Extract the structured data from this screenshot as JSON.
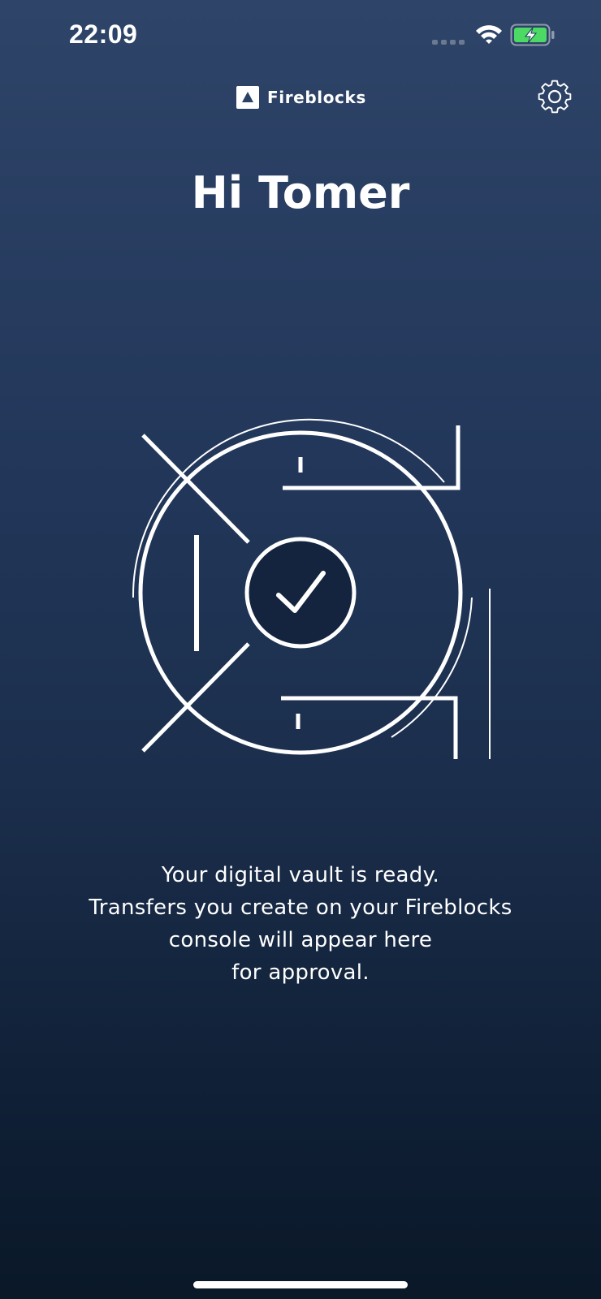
{
  "status_bar": {
    "time": "22:09",
    "icons": [
      "cellular-signal-icon",
      "wifi-icon",
      "battery-charging-icon"
    ],
    "battery_color": "#4cd964"
  },
  "header": {
    "brand_name": "Fireblocks",
    "logo_icon": "fireblocks-logo-icon",
    "settings_icon": "gear-icon"
  },
  "greeting": "Hi Tomer",
  "illustration": {
    "icon": "vault-check-icon",
    "inner_circle_color": "#14243f"
  },
  "message": {
    "lines": [
      "Your digital vault is ready.",
      "Transfers you create on your Fireblocks",
      "console will appear here",
      "for approval."
    ]
  },
  "theme": {
    "background_top": "#2e4468",
    "background_bottom": "#0a1828",
    "foreground": "#ffffff"
  }
}
